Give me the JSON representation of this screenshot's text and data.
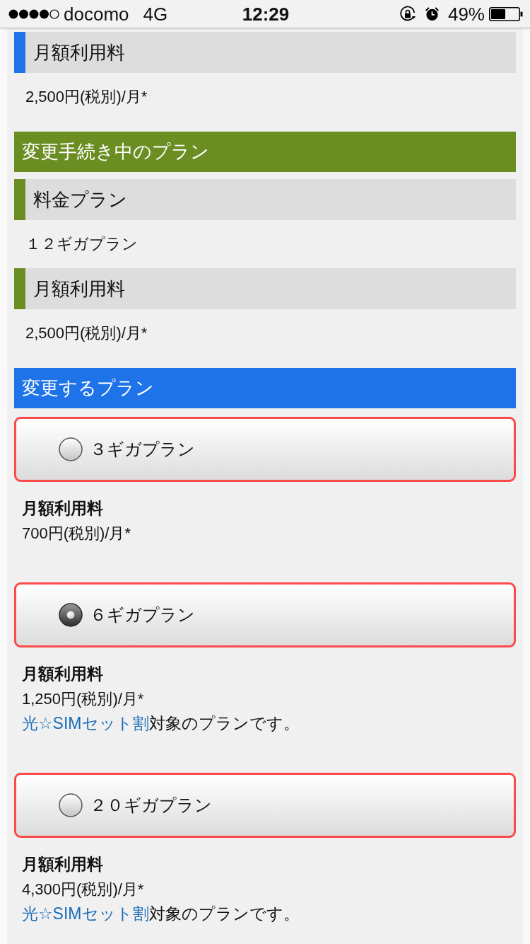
{
  "status_bar": {
    "carrier": "docomo",
    "network": "4G",
    "time": "12:29",
    "battery": "49%"
  },
  "sections": [
    {
      "color": "#1f73e8",
      "fields": [
        {
          "label": "月額利用料",
          "value": "2,500円(税別)/月*"
        }
      ]
    },
    {
      "title": "変更手続き中のプラン",
      "color": "#6b8e23",
      "fields": [
        {
          "label": "料金プラン",
          "value": "１２ギガプラン"
        },
        {
          "label": "月額利用料",
          "value": "2,500円(税別)/月*"
        }
      ]
    },
    {
      "title": "変更するプラン",
      "color": "#1f73e8",
      "options": [
        {
          "label": "３ギガプラン",
          "selected": false,
          "fee_label": "月額利用料",
          "fee": "700円(税別)/月*"
        },
        {
          "label": "６ギガプラン",
          "selected": true,
          "fee_label": "月額利用料",
          "fee": "1,250円(税別)/月*",
          "note": {
            "link": "光☆SIMセット割",
            "text": "対象のプランです。"
          }
        },
        {
          "label": "２０ギガプラン",
          "selected": false,
          "fee_label": "月額利用料",
          "fee": "4,300円(税別)/月*",
          "note": {
            "link": "光☆SIMセット割",
            "text": "対象のプランです。"
          }
        }
      ]
    }
  ]
}
